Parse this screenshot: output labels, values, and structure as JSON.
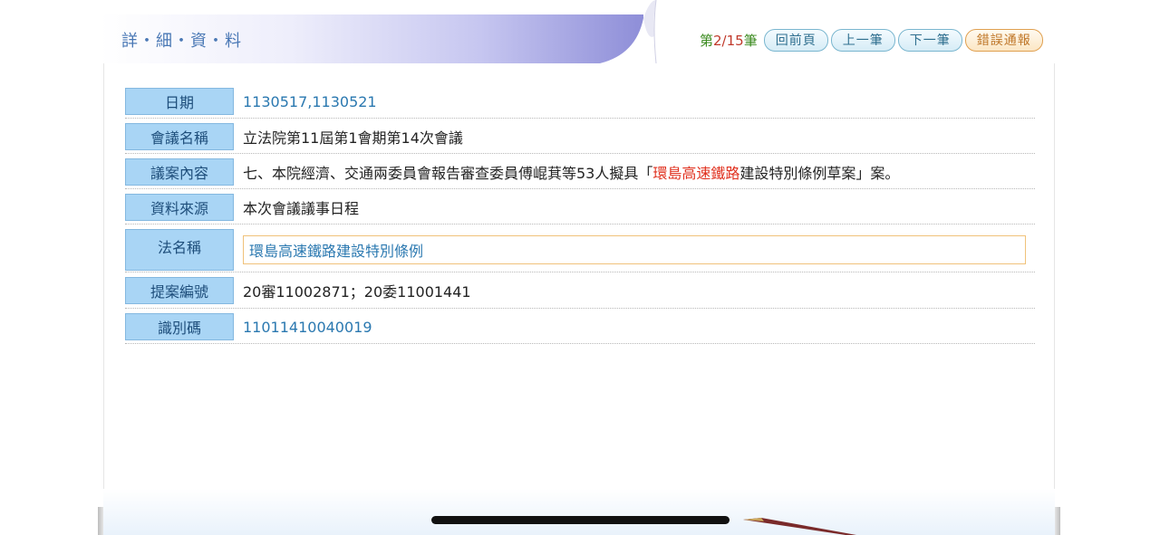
{
  "header": {
    "title": "詳・細・資・料"
  },
  "nav": {
    "record_prefix": "第",
    "record_current_total": "2/15",
    "record_suffix": "筆",
    "back_label": "回前頁",
    "prev_label": "上一筆",
    "next_label": "下一筆",
    "error_label": "錯誤通報"
  },
  "details": {
    "date": {
      "label": "日期",
      "value": "1130517,1130521"
    },
    "meeting": {
      "label": "會議名稱",
      "value": "立法院第11屆第1會期第14次會議"
    },
    "content": {
      "label": "議案內容",
      "prefix": "七、本院經濟、交通兩委員會報告審查委員傅崐萁等53人擬具「",
      "highlight": "環島高速鐵路",
      "suffix": "建設特別條例草案」案。"
    },
    "source": {
      "label": "資料來源",
      "value": "本次會議議事日程"
    },
    "law_name": {
      "label": "法名稱",
      "value": "環島高速鐵路建設特別條例"
    },
    "proposal_no": {
      "label": "提案編號",
      "value": "20審11002871；20委11001441"
    },
    "identifier": {
      "label": "識別碼",
      "value": "11011410040019"
    }
  },
  "colors": {
    "label_bg": "#a9d5f5",
    "link_blue": "#2a78b0",
    "highlight_red": "#e0301e",
    "count_green": "#3a8a1e"
  }
}
